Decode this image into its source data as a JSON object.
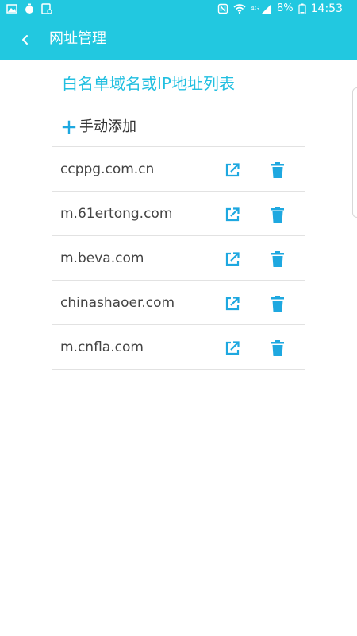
{
  "status_bar": {
    "battery": "8%",
    "time": "14:53",
    "network": "4G",
    "icons": [
      "gallery-icon",
      "timer-icon",
      "screenshot-icon",
      "nfc-icon",
      "wifi-icon",
      "signal-icon",
      "battery-icon"
    ]
  },
  "app_bar": {
    "title": "网址管理",
    "back_icon": "chevron-left-icon"
  },
  "section_title": "白名单域名或IP地址列表",
  "add_label": "手动添加",
  "domains": [
    {
      "name": "ccppg.com.cn"
    },
    {
      "name": "m.61ertong.com"
    },
    {
      "name": "m.beva.com"
    },
    {
      "name": "chinashaoer.com"
    },
    {
      "name": "m.cnfla.com"
    }
  ],
  "row_icons": {
    "open": "external-link-icon",
    "delete": "trash-icon"
  },
  "colors": {
    "primary": "#22c8e0",
    "accent_text": "#22bfe0",
    "icon": "#1ea8e0",
    "text": "#444444",
    "divider": "#e2e2e2"
  }
}
